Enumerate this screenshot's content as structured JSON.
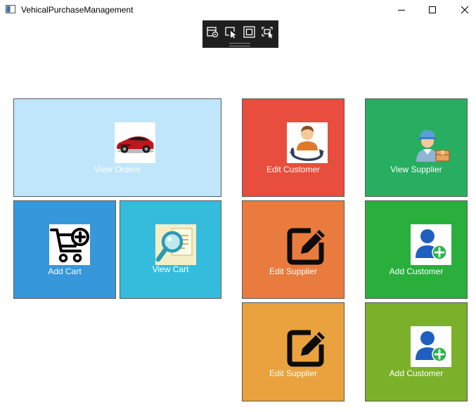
{
  "window": {
    "title": "VehicalPurchaseManagement",
    "controls": [
      "minimize-icon",
      "maximize-icon",
      "close-icon"
    ]
  },
  "debug_toolbar": {
    "icons": [
      "live-visual-tree-icon",
      "select-element-icon",
      "display-layout-adorners-icon",
      "track-focused-element-icon"
    ]
  },
  "tiles": [
    {
      "label": "View Orders",
      "color": "#bfe6fb",
      "icon": "car-icon"
    },
    {
      "label": "Add Cart",
      "color": "#3697db",
      "icon": "cart-add-icon"
    },
    {
      "label": "View Cart",
      "color": "#35bcdd",
      "icon": "magnifier-document-icon"
    },
    {
      "label": "Edit Customer",
      "color": "#e84d3d",
      "icon": "user-sync-icon"
    },
    {
      "label": "Edit Supplier",
      "color": "#e87b3d",
      "icon": "edit-icon"
    },
    {
      "label": "Edit Supplier",
      "color": "#e9a23d",
      "icon": "edit-icon"
    },
    {
      "label": "View Supplier",
      "color": "#27ae61",
      "icon": "delivery-worker-icon"
    },
    {
      "label": "Add Customer",
      "color": "#2aaf3c",
      "icon": "add-user-icon"
    },
    {
      "label": "Add Customer",
      "color": "#7bb02b",
      "icon": "add-user-icon"
    }
  ]
}
